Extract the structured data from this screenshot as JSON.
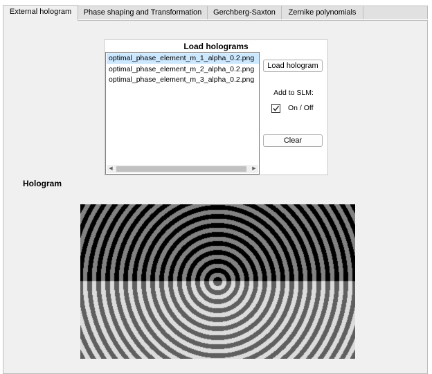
{
  "tabs": [
    {
      "label": "External hologram",
      "active": true
    },
    {
      "label": "Phase shaping and Transformation",
      "active": false
    },
    {
      "label": "Gerchberg-Saxton",
      "active": false
    },
    {
      "label": "Zernike polynomials",
      "active": false
    }
  ],
  "load_panel": {
    "title": "Load holograms",
    "files": [
      "optimal_phase_element_m_1_alpha_0.2.png",
      "optimal_phase_element_m_2_alpha_0.2.png",
      "optimal_phase_element_m_3_alpha_0.2.png"
    ],
    "selected_index": 0,
    "load_button": "Load hologram",
    "add_label": "Add to SLM:",
    "toggle_label": "On / Off",
    "toggle_checked": true,
    "clear_button": "Clear"
  },
  "hologram": {
    "title": "Hologram"
  },
  "colors": {
    "panel_bg": "#f0f0f0",
    "selected_row": "#cce8ff"
  }
}
